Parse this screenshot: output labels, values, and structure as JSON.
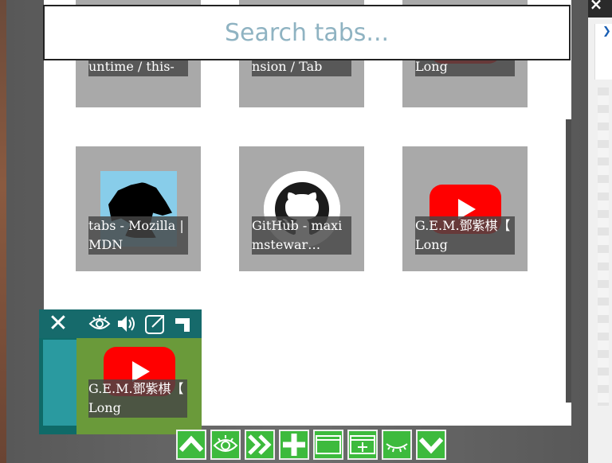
{
  "search": {
    "placeholder": "Search tabs..."
  },
  "tabs": [
    {
      "title": "Debugging - Runtime / this-",
      "thumb": "mdn-fragment"
    },
    {
      "title": "Toolbox - Extension / Tab",
      "thumb": "toolbox-fragment"
    },
    {
      "title": "G.E.M.鄧紫棋【 Long",
      "thumb": "youtube-logo"
    },
    {
      "title": "tabs - Mozilla | MDN",
      "thumb": "mdn-dino-logo"
    },
    {
      "title": "GitHub - maximstewar…",
      "thumb": "github-logo"
    },
    {
      "title": "G.E.M.鄧紫棋【 Long",
      "thumb": "youtube-logo"
    }
  ],
  "selected_tab": {
    "title": "G.E.M.鄧紫棋【 Long",
    "actions": [
      "close-icon",
      "eye-icon",
      "speaker-icon",
      "popout-icon",
      "corner-icon"
    ]
  },
  "bottom_buttons": [
    "chevron-up-icon",
    "eye-icon",
    "double-chevron-right-icon",
    "plus-icon",
    "window-icon",
    "new-window-icon",
    "closed-eye-icon",
    "chevron-down-icon"
  ],
  "colors": {
    "accent": "#3dba3d",
    "selected": "#166a6b",
    "youtube": "#ff0000"
  }
}
